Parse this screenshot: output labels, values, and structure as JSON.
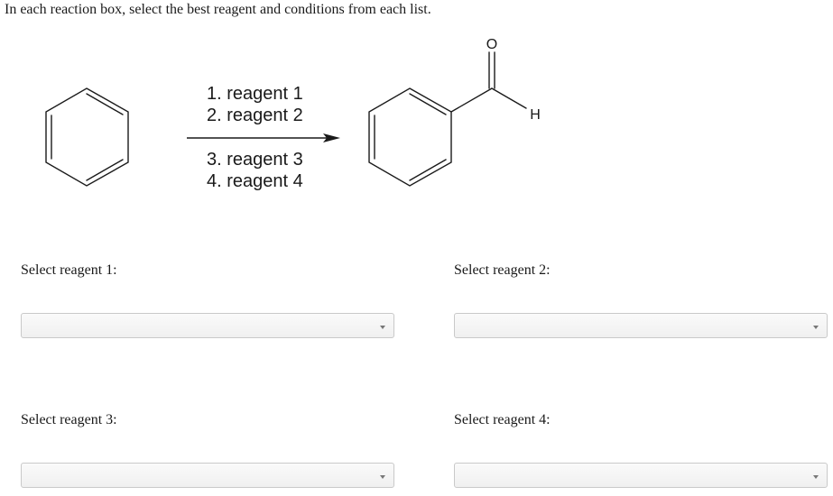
{
  "instruction": "In each reaction box, select the best reagent and conditions from each list.",
  "reaction": {
    "step1": "1. reagent 1",
    "step2": "2. reagent 2",
    "step3": "3. reagent 3",
    "step4": "4. reagent 4",
    "carbonyl_oxygen": "O",
    "aldehyde_hydrogen": "H"
  },
  "selects": [
    {
      "label": "Select reagent 1:",
      "value": ""
    },
    {
      "label": "Select reagent 2:",
      "value": ""
    },
    {
      "label": "Select reagent 3:",
      "value": ""
    },
    {
      "label": "Select reagent 4:",
      "value": ""
    }
  ]
}
